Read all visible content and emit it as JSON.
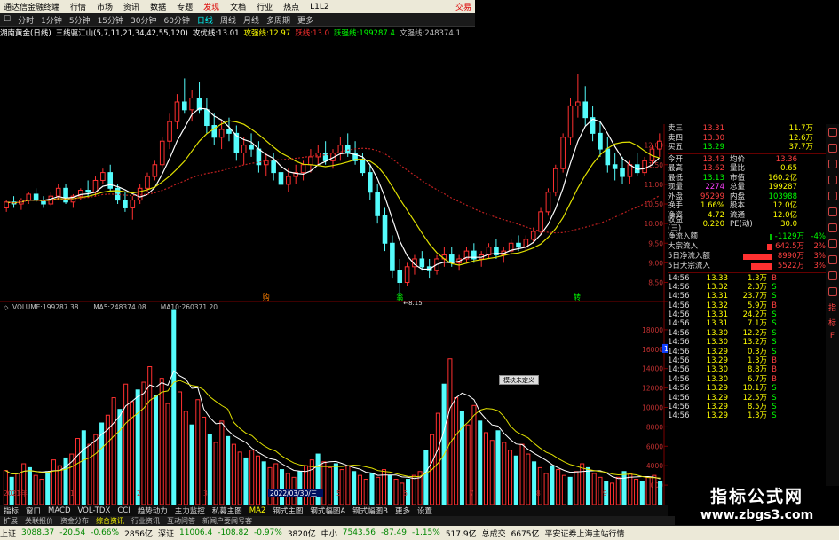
{
  "menubar": {
    "title": "通达信金融终端",
    "items": [
      "行情",
      "市场",
      "资讯",
      "数据",
      "专题",
      "发现",
      "文档",
      "行业",
      "热点",
      "L1L2"
    ],
    "close_label": "交易"
  },
  "periods": [
    "分时",
    "1分钟",
    "5分钟",
    "15分钟",
    "30分钟",
    "60分钟",
    "日线",
    "周线",
    "月线",
    "多周期",
    "更多"
  ],
  "active_period": "日线",
  "infobar": {
    "stock_name": "湖南黄金(日线)",
    "indicator": "三线驱江山(5,7,11,21,34,42,55,120)",
    "items": [
      {
        "label": "攻优线:",
        "value": "13.01",
        "color": "#ffffff"
      },
      {
        "label": "攻强线:",
        "value": "12.97",
        "color": "#ffff00"
      },
      {
        "label": "跃线:",
        "value": "13.0",
        "color": "#ff3030"
      },
      {
        "label": "跃强线:",
        "value": "199287.4",
        "color": "#00ff00"
      },
      {
        "label": "文强线:",
        "value": "248374.1",
        "color": "#c0c0c0"
      }
    ]
  },
  "chart_data": [
    {
      "type": "candlestick",
      "title": "湖南黄金(日线)",
      "price_axis_ticks": [
        12.0,
        11.5,
        11.0,
        10.5,
        10.0,
        9.5,
        9.0,
        8.5
      ],
      "ylim": [
        8.15,
        13.8
      ],
      "low_annotation": "8.15",
      "markers": [
        "购",
        "翁",
        "转"
      ],
      "candles": [
        [
          10.4,
          10.6,
          10.3,
          10.55
        ],
        [
          10.55,
          10.7,
          10.4,
          10.5
        ],
        [
          10.5,
          10.65,
          10.35,
          10.6
        ],
        [
          10.6,
          10.8,
          10.5,
          10.75
        ],
        [
          10.75,
          10.9,
          10.55,
          10.6
        ],
        [
          10.6,
          10.7,
          10.4,
          10.5
        ],
        [
          10.5,
          10.8,
          10.45,
          10.7
        ],
        [
          10.7,
          11.0,
          10.6,
          10.9
        ],
        [
          10.9,
          11.0,
          10.5,
          10.55
        ],
        [
          10.55,
          10.75,
          10.4,
          10.7
        ],
        [
          10.7,
          10.9,
          10.6,
          10.85
        ],
        [
          10.85,
          11.1,
          10.7,
          10.8
        ],
        [
          10.8,
          11.2,
          10.7,
          11.1
        ],
        [
          11.1,
          11.4,
          11.0,
          11.3
        ],
        [
          11.3,
          11.5,
          10.8,
          10.9
        ],
        [
          10.9,
          11.0,
          10.5,
          10.6
        ],
        [
          10.6,
          10.8,
          10.3,
          10.4
        ],
        [
          10.4,
          10.7,
          10.1,
          10.6
        ],
        [
          10.6,
          11.0,
          10.5,
          10.9
        ],
        [
          10.9,
          11.3,
          10.8,
          11.2
        ],
        [
          11.2,
          11.6,
          11.1,
          11.5
        ],
        [
          11.5,
          12.2,
          11.4,
          12.1
        ],
        [
          12.1,
          12.8,
          11.9,
          12.6
        ],
        [
          12.6,
          13.3,
          12.4,
          13.1
        ],
        [
          13.1,
          13.7,
          12.8,
          12.9
        ],
        [
          12.9,
          13.4,
          12.6,
          13.2
        ],
        [
          13.2,
          13.6,
          12.8,
          12.9
        ],
        [
          12.9,
          13.2,
          12.3,
          12.5
        ],
        [
          12.5,
          12.8,
          12.0,
          12.2
        ],
        [
          12.2,
          12.6,
          11.9,
          12.4
        ],
        [
          12.4,
          12.7,
          12.1,
          12.3
        ],
        [
          12.3,
          12.5,
          11.6,
          11.8
        ],
        [
          11.8,
          12.2,
          11.5,
          12.0
        ],
        [
          12.0,
          12.3,
          11.7,
          11.9
        ],
        [
          11.9,
          12.1,
          11.3,
          11.5
        ],
        [
          11.5,
          11.8,
          11.2,
          11.6
        ],
        [
          11.6,
          11.8,
          11.1,
          11.3
        ],
        [
          11.3,
          11.5,
          10.9,
          11.0
        ],
        [
          11.0,
          11.4,
          10.8,
          11.2
        ],
        [
          11.2,
          11.5,
          11.0,
          11.3
        ],
        [
          11.3,
          11.6,
          11.1,
          11.5
        ],
        [
          11.5,
          11.9,
          11.3,
          11.7
        ],
        [
          11.7,
          12.0,
          11.5,
          11.8
        ],
        [
          11.8,
          12.1,
          11.5,
          11.6
        ],
        [
          11.6,
          11.9,
          11.4,
          11.8
        ],
        [
          11.8,
          12.2,
          11.6,
          12.0
        ],
        [
          12.0,
          12.3,
          11.7,
          11.8
        ],
        [
          11.8,
          12.1,
          11.5,
          11.6
        ],
        [
          11.6,
          11.8,
          11.2,
          11.3
        ],
        [
          11.3,
          11.5,
          10.6,
          10.8
        ],
        [
          10.8,
          11.0,
          10.0,
          10.2
        ],
        [
          10.2,
          10.4,
          9.3,
          9.5
        ],
        [
          9.5,
          9.7,
          8.6,
          8.8
        ],
        [
          8.8,
          9.1,
          8.15,
          8.5
        ],
        [
          8.5,
          9.0,
          8.4,
          8.9
        ],
        [
          8.9,
          9.2,
          8.7,
          9.1
        ],
        [
          9.1,
          9.3,
          8.8,
          8.9
        ],
        [
          8.9,
          9.1,
          8.6,
          8.8
        ],
        [
          8.8,
          9.2,
          8.7,
          9.1
        ],
        [
          9.1,
          9.4,
          8.9,
          9.2
        ],
        [
          9.2,
          9.4,
          8.9,
          9.0
        ],
        [
          9.0,
          9.2,
          8.8,
          9.1
        ],
        [
          9.1,
          9.4,
          9.0,
          9.3
        ],
        [
          9.3,
          9.5,
          9.0,
          9.1
        ],
        [
          9.1,
          9.3,
          8.9,
          9.2
        ],
        [
          9.2,
          9.5,
          9.1,
          9.4
        ],
        [
          9.4,
          9.6,
          9.1,
          9.2
        ],
        [
          9.2,
          9.4,
          9.0,
          9.3
        ],
        [
          9.3,
          9.6,
          9.2,
          9.5
        ],
        [
          9.5,
          9.7,
          9.3,
          9.4
        ],
        [
          9.4,
          9.7,
          9.3,
          9.6
        ],
        [
          9.6,
          9.9,
          9.5,
          9.8
        ],
        [
          9.8,
          10.4,
          9.7,
          10.3
        ],
        [
          10.3,
          10.9,
          10.2,
          10.8
        ],
        [
          10.8,
          11.5,
          10.7,
          11.4
        ],
        [
          11.4,
          12.3,
          11.3,
          12.2
        ],
        [
          12.2,
          13.2,
          12.0,
          13.0
        ],
        [
          13.0,
          13.8,
          12.7,
          13.1
        ],
        [
          13.1,
          13.5,
          12.5,
          12.7
        ],
        [
          12.7,
          13.0,
          12.1,
          12.3
        ],
        [
          12.3,
          12.6,
          11.7,
          11.9
        ],
        [
          11.9,
          12.2,
          11.3,
          11.5
        ],
        [
          11.5,
          11.8,
          11.1,
          11.4
        ],
        [
          11.4,
          11.7,
          11.0,
          11.2
        ],
        [
          11.2,
          11.6,
          11.0,
          11.5
        ],
        [
          11.5,
          11.8,
          11.2,
          11.3
        ],
        [
          11.3,
          11.7,
          11.2,
          11.6
        ],
        [
          11.6,
          12.0,
          11.5,
          11.9
        ],
        [
          11.9,
          12.3,
          11.7,
          12.1
        ]
      ]
    },
    {
      "type": "bar",
      "title": "VOLUME",
      "legend": [
        {
          "label": "VOLUME:",
          "value": "199287.38",
          "color": "#c0c0c0"
        },
        {
          "label": "MA5:",
          "value": "248374.08",
          "color": "#c0c0c0"
        },
        {
          "label": "MA10:",
          "value": "260371.20",
          "color": "#c0c0c0"
        }
      ],
      "vol_axis_ticks": [
        18000,
        16000,
        14000,
        12000,
        10000,
        8000,
        6000,
        4000,
        2000
      ],
      "ylim": [
        0,
        20000
      ],
      "highlight_tick": "15988",
      "date_axis": [
        "2021年",
        "1",
        "2",
        "3",
        "2022/03/30/三",
        "5",
        "6",
        "7",
        "8",
        "9"
      ],
      "values": [
        3500,
        2800,
        3200,
        4200,
        3800,
        3000,
        2600,
        3400,
        4600,
        4000,
        4800,
        5200,
        6800,
        7600,
        6200,
        7200,
        8400,
        9200,
        11000,
        9800,
        12400,
        10600,
        11800,
        12600,
        14200,
        11200,
        13000,
        10400,
        20000,
        11600,
        9600,
        8200,
        10800,
        9000,
        7200,
        6400,
        8600,
        7000,
        6200,
        5400,
        4800,
        5600,
        5000,
        4400,
        3800,
        4200,
        3600,
        3200,
        2800,
        3400,
        4000,
        4600,
        5200,
        4400,
        3800,
        4200,
        3600,
        4000,
        3400,
        3000,
        2600,
        3200,
        2800,
        3600,
        3000,
        2600,
        2200,
        2600,
        3000,
        3400,
        5600,
        7200,
        9400,
        12400,
        15000,
        11000,
        9600,
        8200,
        10200,
        8600,
        7400,
        6600,
        7600,
        6400,
        5600,
        5000,
        6200,
        5200,
        4400,
        3800,
        3200,
        4000,
        3600,
        3000,
        2800,
        3400,
        4200,
        3800,
        3200,
        2800,
        2400,
        2200,
        2800,
        3400,
        3200,
        2600,
        2400,
        2800,
        3000,
        2400
      ]
    }
  ],
  "quotes": {
    "order_book": [
      {
        "label": "卖三",
        "price": "13.31",
        "vol": "11.7万",
        "color": "#ff4040"
      },
      {
        "label": "卖四",
        "price": "13.30",
        "vol": "12.6万",
        "color": "#ff4040"
      },
      {
        "label": "买五",
        "price": "13.29",
        "vol": "37.7万",
        "color": "#00ff00"
      }
    ],
    "stats": [
      {
        "l1": "今开",
        "v1": "13.43",
        "c1": "#ff4040",
        "l2": "均价",
        "v2": "13.36",
        "c2": "#ff4040"
      },
      {
        "l1": "最高",
        "v1": "13.62",
        "c1": "#ff4040",
        "l2": "量比",
        "v2": "0.65",
        "c2": "#ffff00"
      },
      {
        "l1": "最低",
        "v1": "13.13",
        "c1": "#00ff00",
        "l2": "市值",
        "v2": "160.2亿",
        "c2": "#ffff00"
      },
      {
        "l1": "现量",
        "v1": "2274",
        "c1": "#ff40ff",
        "l2": "总量",
        "v2": "199287",
        "c2": "#ffff00"
      },
      {
        "l1": "外盘",
        "v1": "95299",
        "c1": "#ff4040",
        "l2": "内盘",
        "v2": "103988",
        "c2": "#00ff00"
      },
      {
        "l1": "换手",
        "v1": "1.66%",
        "c1": "#ffff00",
        "l2": "股本",
        "v2": "12.0亿",
        "c2": "#ffff00"
      },
      {
        "l1": "净资",
        "v1": "4.72",
        "c1": "#ffff00",
        "l2": "流通",
        "v2": "12.0亿",
        "c2": "#ffff00"
      },
      {
        "l1": "收益(三)",
        "v1": "0.220",
        "c1": "#ffff00",
        "l2": "PE(动)",
        "v2": "30.0",
        "c2": "#ffff00"
      }
    ],
    "flows": [
      {
        "label": "净流入额",
        "value": "-1129万",
        "pct": "-4%",
        "bar": 0.05,
        "bar_color": "#00c000",
        "val_color": "#00ff00"
      },
      {
        "label": "大宗流入",
        "value": "642.5万",
        "pct": "2%",
        "bar": 0.1,
        "bar_color": "#ff3030",
        "val_color": "#ff4040"
      },
      {
        "label": "5日净流入额",
        "value": "8990万",
        "pct": "3%",
        "bar": 0.55,
        "bar_color": "#ff3030",
        "val_color": "#ff4040"
      },
      {
        "label": "5日大宗流入",
        "value": "5522万",
        "pct": "3%",
        "bar": 0.4,
        "bar_color": "#ff3030",
        "val_color": "#ff4040"
      }
    ],
    "ticks": [
      {
        "t": "14:56",
        "p": "13.33",
        "v": "1.3万",
        "bs": "B"
      },
      {
        "t": "14:56",
        "p": "13.32",
        "v": "2.3万",
        "bs": "S"
      },
      {
        "t": "14:56",
        "p": "13.31",
        "v": "23.7万",
        "bs": "S"
      },
      {
        "t": "14:56",
        "p": "13.32",
        "v": "5.9万",
        "bs": "B"
      },
      {
        "t": "14:56",
        "p": "13.31",
        "v": "24.2万",
        "bs": "S"
      },
      {
        "t": "14:56",
        "p": "13.31",
        "v": "7.1万",
        "bs": "S"
      },
      {
        "t": "14:56",
        "p": "13.30",
        "v": "12.2万",
        "bs": "S"
      },
      {
        "t": "14:56",
        "p": "13.30",
        "v": "13.2万",
        "bs": "S"
      },
      {
        "t": "14:56",
        "p": "13.29",
        "v": "0.3万",
        "bs": "S"
      },
      {
        "t": "14:56",
        "p": "13.29",
        "v": "1.3万",
        "bs": "B"
      },
      {
        "t": "14:56",
        "p": "13.30",
        "v": "8.8万",
        "bs": "B"
      },
      {
        "t": "14:56",
        "p": "13.30",
        "v": "6.7万",
        "bs": "B"
      },
      {
        "t": "14:56",
        "p": "13.29",
        "v": "10.1万",
        "bs": "S"
      },
      {
        "t": "14:56",
        "p": "13.29",
        "v": "12.5万",
        "bs": "S"
      },
      {
        "t": "14:56",
        "p": "13.29",
        "v": "8.5万",
        "bs": "S"
      },
      {
        "t": "14:56",
        "p": "13.29",
        "v": "1.3万",
        "bs": "S"
      }
    ]
  },
  "float_button": "模块未定义",
  "indicator_tabs": [
    "指标",
    "窗口",
    "MACD",
    "VOL-TDX",
    "CCI",
    "趋势动力",
    "主力监控",
    "私募主图",
    "MA2",
    "钢式主图",
    "钢式幅图A",
    "钢式幅图B",
    "更多",
    "设置"
  ],
  "active_indicator": "MA2",
  "bottom_tabs": [
    "扩展",
    "关联报价",
    "资金分布",
    "综合资讯",
    "行业资讯",
    "互动问答",
    "新闻户要闻号客"
  ],
  "active_bottom_tab": "综合资讯",
  "right_toolbar_labels": [
    "指",
    "标",
    "F"
  ],
  "status": [
    {
      "label": "上证",
      "value": "3088.37",
      "chg": "-20.54",
      "pct": "-0.66%",
      "amt": "2856亿"
    },
    {
      "label": "深证",
      "value": "11006.4",
      "chg": "-108.82",
      "pct": "-0.97%",
      "amt": "3820亿"
    },
    {
      "label": "中小",
      "value": "7543.56",
      "chg": "-87.49",
      "pct": "-1.15%",
      "amt": "517.9亿"
    }
  ],
  "status_extra": {
    "label": "总成交",
    "value": "6675亿",
    "server": "平安证券上海主站行情"
  },
  "watermark": {
    "line1": "指标公式网",
    "line2": "www.zbgs3.com"
  }
}
